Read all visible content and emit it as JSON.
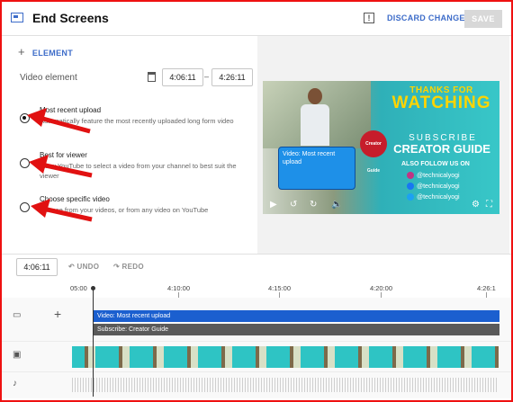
{
  "header": {
    "title": "End Screens",
    "discard_label": "DISCARD CHANGES",
    "save_label": "SAVE"
  },
  "editor": {
    "add_element_label": "ELEMENT",
    "video_element_label": "Video element",
    "start_time": "4:06:11",
    "end_time": "4:26:11",
    "options": [
      {
        "title": "Most recent upload",
        "desc": "Automatically feature the most recently uploaded long form video",
        "selected": true
      },
      {
        "title": "Best for viewer",
        "desc": "Allow YouTube to select a video from your channel to best suit the viewer",
        "selected": false
      },
      {
        "title": "Choose specific video",
        "desc": "Choose from your videos, or from any video on YouTube",
        "selected": false
      }
    ]
  },
  "preview": {
    "thanks_text": "THANKS FOR",
    "watching_text": "WATCHING",
    "subscribe_text": "SUBSCRIBE",
    "creator_text": "CREATOR GUIDE",
    "follow_text": "ALSO FOLLOW US ON",
    "socials": [
      {
        "handle": "@technicalyogi",
        "color": "#c13584"
      },
      {
        "handle": "@technicalyogi",
        "color": "#1877f2"
      },
      {
        "handle": "@technicalyogi",
        "color": "#1da1f2"
      }
    ],
    "logo_text": "Creator Guide",
    "element_box_label": "Video: Most recent upload"
  },
  "timeline": {
    "current_time": "4:06:11",
    "undo_label": "UNDO",
    "redo_label": "REDO",
    "ticks": [
      "05:00",
      "4:10:00",
      "4:15:00",
      "4:20:00",
      "4:26:1"
    ],
    "video_bar_label": "Video: Most recent upload",
    "subscribe_bar_label": "Subscribe: Creator Guide"
  },
  "colors": {
    "accent": "#3d6cc9",
    "video_bar": "#1b5fcf",
    "subscribe_bar": "#5a5a5a",
    "annotation_arrow": "#e11111"
  }
}
